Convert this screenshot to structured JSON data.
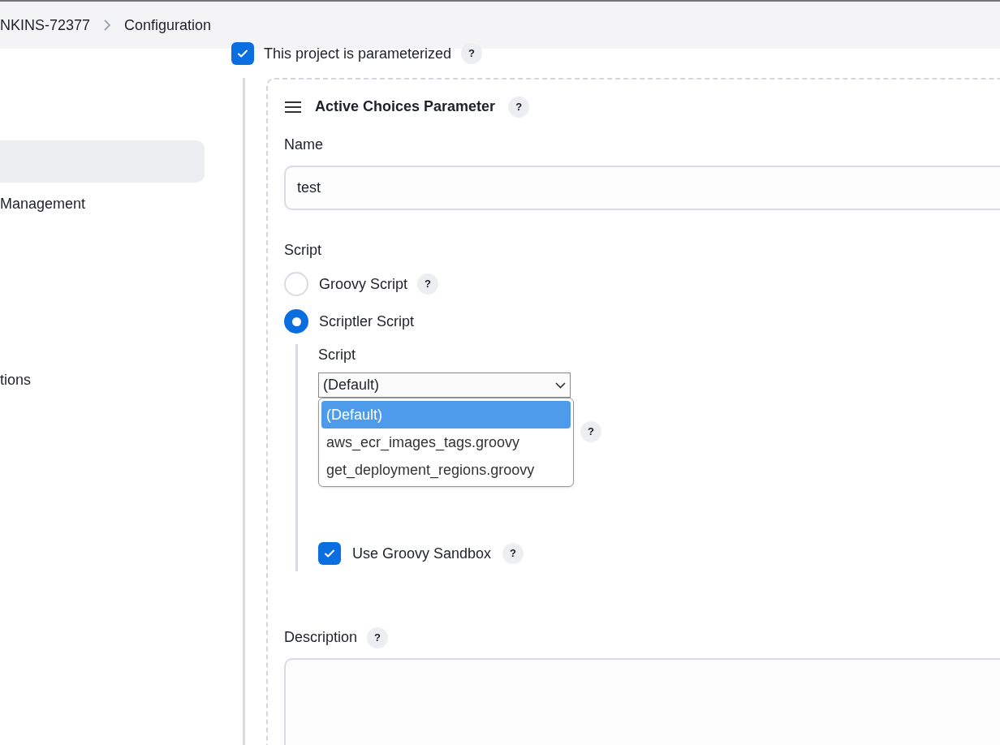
{
  "breadcrumb": [
    {
      "label": "NKINS-72377"
    },
    {
      "label": "Configuration"
    }
  ],
  "sidebar": {
    "items": [
      {
        "selected": true
      },
      {
        "label": "Management",
        "selected": false
      },
      {
        "label": "tions",
        "selected": false
      }
    ]
  },
  "parameterized": {
    "label": "This project is parameterized",
    "checked": true,
    "help": "?"
  },
  "parameter": {
    "title": "Active Choices Parameter",
    "help": "?",
    "name_label": "Name",
    "name_value": "test",
    "script_label": "Script",
    "script_options": [
      {
        "label": "Groovy Script",
        "selected": false,
        "help": "?"
      },
      {
        "label": "Scriptler Script",
        "selected": true
      }
    ],
    "scriptler": {
      "label": "Script",
      "select_value": "(Default)",
      "menu": [
        {
          "label": "(Default)",
          "selected": true
        },
        {
          "label": "aws_ecr_images_tags.groovy",
          "selected": false
        },
        {
          "label": "get_deployment_regions.groovy",
          "selected": false
        }
      ],
      "covered_rows": [
        {
          "help": "?"
        }
      ],
      "sandbox": {
        "label": "Use Groovy Sandbox",
        "checked": true,
        "help": "?"
      }
    },
    "description_label": "Description",
    "description_help": "?"
  }
}
